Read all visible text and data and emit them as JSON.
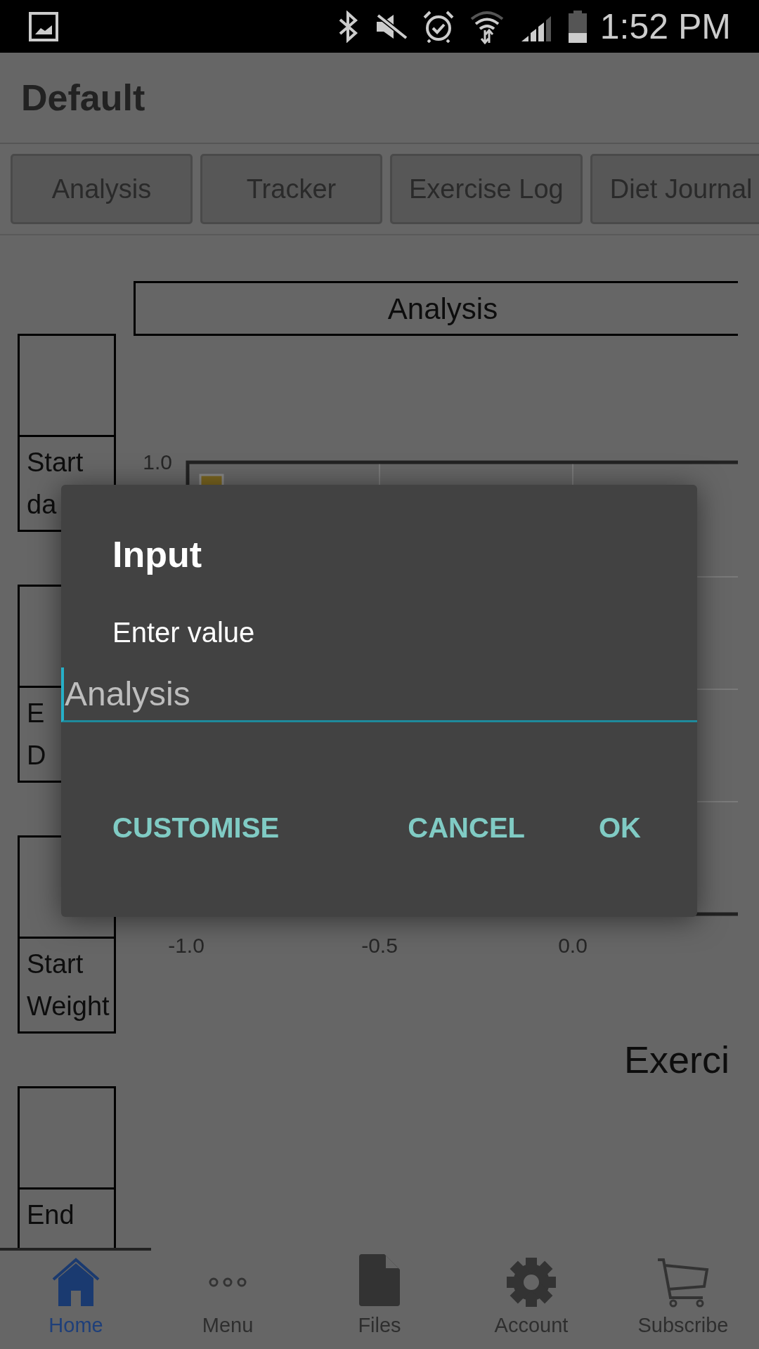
{
  "status_bar": {
    "time": "1:52 PM"
  },
  "app_bar": {
    "title": "Default"
  },
  "tabs": [
    {
      "label": "Analysis"
    },
    {
      "label": "Tracker"
    },
    {
      "label": "Exercise Log"
    },
    {
      "label": "Diet Journal"
    }
  ],
  "summary_boxes": [
    {
      "label_lines": [
        "Start",
        "da"
      ]
    },
    {
      "label_lines": [
        "E",
        "D"
      ]
    },
    {
      "label_lines": [
        "Start",
        "Weight"
      ]
    },
    {
      "label_lines": [
        "End"
      ]
    }
  ],
  "chart_heading": "Analysis",
  "chart": {
    "y_axis_label": "1.0",
    "x_tick_labels": [
      "-1.0",
      "-0.5",
      "0.0"
    ]
  },
  "section_heading": "Exerci",
  "dialog": {
    "title": "Input",
    "message": "Enter value",
    "field": {
      "placeholder": "Analysis"
    },
    "buttons": [
      "CUSTOMISE",
      "CANCEL",
      "OK"
    ]
  },
  "bottom_nav": [
    {
      "label": "Home",
      "selected": true,
      "kind": "home"
    },
    {
      "label": "Menu",
      "selected": false,
      "kind": "menu"
    },
    {
      "label": "Files",
      "selected": false,
      "kind": "files"
    },
    {
      "label": "Account",
      "selected": false,
      "kind": "account"
    },
    {
      "label": "Subscribe",
      "selected": false,
      "kind": "subscribe"
    }
  ]
}
